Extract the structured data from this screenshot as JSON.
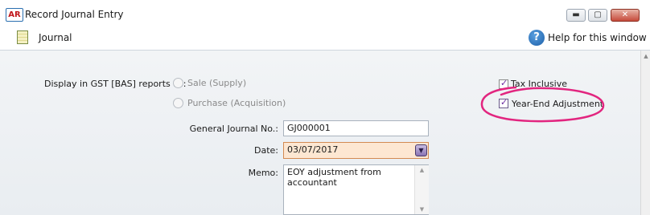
{
  "window": {
    "app_icon_text": "AR",
    "title": "Record Journal Entry",
    "controls": {
      "minimize": "▬",
      "maximize": "▢",
      "close": "✕"
    }
  },
  "toolbar": {
    "section_label": "Journal",
    "help_label": "Help for this window",
    "help_icon_glyph": "?"
  },
  "form": {
    "gst_label": "Display in GST [BAS] reports as:",
    "gst_options": [
      {
        "label": "Sale (Supply)",
        "selected": false,
        "disabled": true
      },
      {
        "label": "Purchase (Acquisition)",
        "selected": false,
        "disabled": true
      }
    ],
    "tax_inclusive": {
      "label": "Tax Inclusive",
      "checked": true
    },
    "year_end_adjustment": {
      "label": "Year-End Adjustment",
      "checked": true
    },
    "journal_no": {
      "label": "General Journal No.:",
      "value": "GJ000001"
    },
    "date": {
      "label": "Date:",
      "value": "03/07/2017"
    },
    "memo": {
      "label": "Memo:",
      "value": "EOY adjustment from\naccountant"
    }
  },
  "colors": {
    "highlight": "#e2257f",
    "date_field_bg": "#fde7d2",
    "checkbox_tick": "#6a2aa0"
  }
}
